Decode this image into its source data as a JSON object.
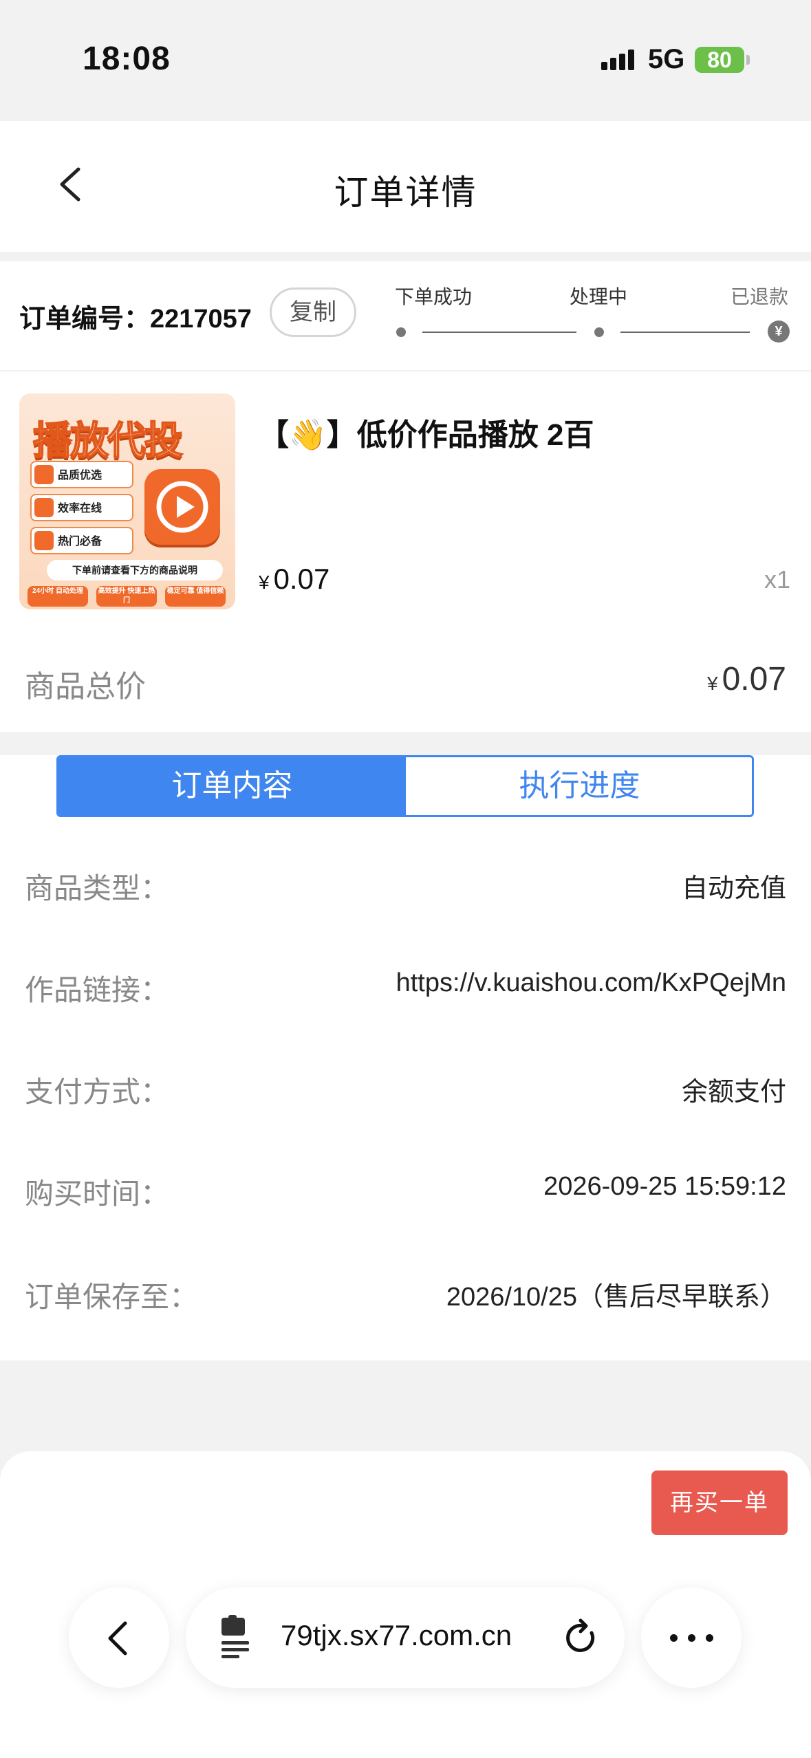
{
  "status_bar": {
    "time": "18:08",
    "network": "5G",
    "battery": "80"
  },
  "nav": {
    "title": "订单详情"
  },
  "order": {
    "number_label": "订单编号：2217057",
    "copy_label": "复制",
    "steps": [
      "下单成功",
      "处理中",
      "已退款"
    ],
    "refund_icon_char": "¥"
  },
  "product": {
    "name": "【👋】低价作品播放 2百",
    "currency": "¥",
    "price": "0.07",
    "qty": "x1",
    "thumb": {
      "title": "播放代投",
      "rows": [
        "品质优选",
        "效率在线",
        "热门必备"
      ],
      "banner": "下单前请查看下方的商品说明",
      "foot": [
        "24小时 自动处理",
        "高效提升 快速上热门",
        "稳定可靠 值得信赖"
      ]
    }
  },
  "total": {
    "label": "商品总价",
    "currency": "¥",
    "value": "0.07"
  },
  "tabs": {
    "content": "订单内容",
    "progress": "执行进度"
  },
  "details": [
    {
      "key": "商品类型：",
      "value": "自动充值"
    },
    {
      "key": "作品链接：",
      "value": "https://v.kuaishou.com/KxPQejMn"
    },
    {
      "key": "支付方式：",
      "value": "余额支付"
    },
    {
      "key": "购买时间：",
      "value": "2026-09-25 15:59:12"
    },
    {
      "key": "订单保存至：",
      "value": "2026/10/25（售后尽早联系）"
    }
  ],
  "actions": {
    "rebuy": "再买一单"
  },
  "browser": {
    "url": "79tjx.sx77.com.cn"
  },
  "colors": {
    "accent": "#3f86f0",
    "rebuy": "#e85a50",
    "battery": "#6cc04a"
  }
}
